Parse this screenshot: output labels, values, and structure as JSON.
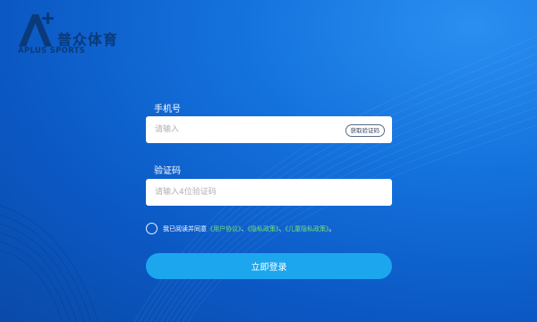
{
  "brand": {
    "name_cn": "普众体育",
    "name_en": "APLUS SPORTS"
  },
  "form": {
    "phone": {
      "label": "手机号",
      "placeholder": "请输入",
      "value": "",
      "get_code_label": "获取验证码"
    },
    "code": {
      "label": "验证码",
      "placeholder": "请输入4位验证码",
      "value": ""
    },
    "agreement": {
      "prefix": "我已阅读并同意",
      "user_agreement": "《用户协议》",
      "sep1": "、",
      "privacy_policy": "《隐私政策》",
      "sep2": "、",
      "child_privacy_policy": "《儿童隐私政策》",
      "suffix": "。"
    },
    "login_label": "立即登录"
  },
  "colors": {
    "background": "#0b58c4",
    "login_button": "#1ca6ee",
    "link": "#79e070",
    "logo": "#0b3a7a"
  },
  "icons": {
    "logo_mark": "a-plus-logo-icon",
    "agreement_check": "radio-circle-icon"
  }
}
